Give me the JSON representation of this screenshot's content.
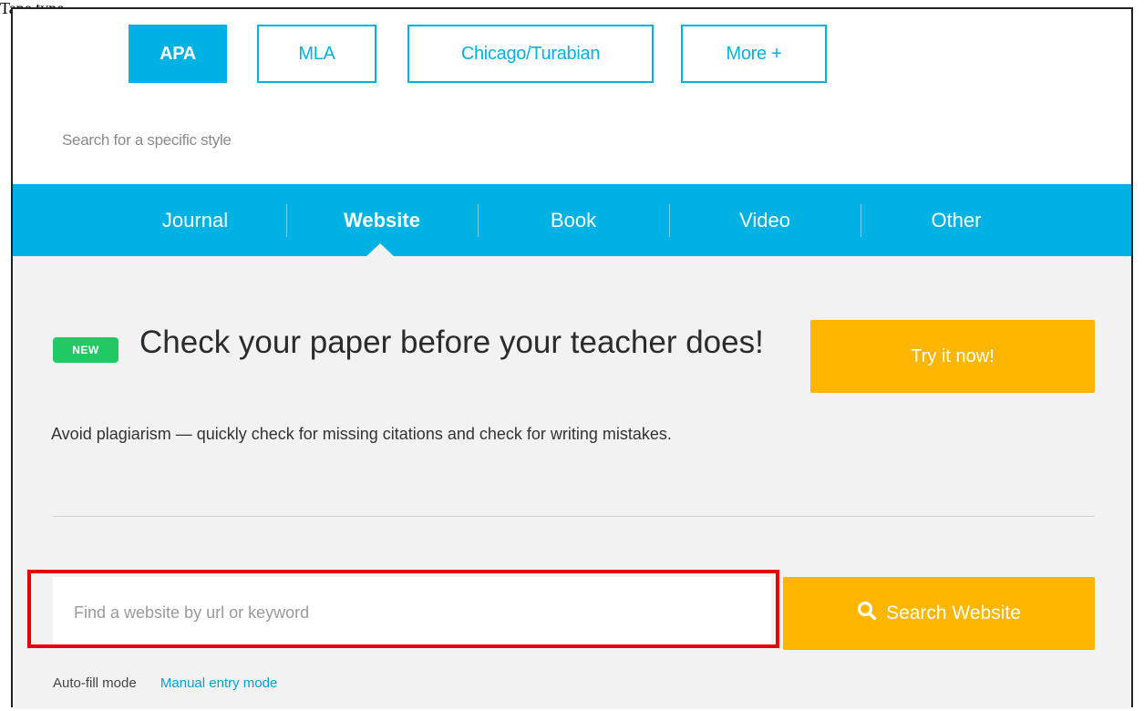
{
  "top_caption": "Tape type",
  "citation_styles": {
    "tabs": [
      {
        "label": "APA",
        "active": true
      },
      {
        "label": "MLA",
        "active": false
      },
      {
        "label": "Chicago/Turabian",
        "active": false
      },
      {
        "label": "More +",
        "active": false
      }
    ],
    "search_placeholder": "Search for a specific style"
  },
  "source_types": {
    "tabs": [
      {
        "label": "Journal",
        "active": false
      },
      {
        "label": "Website",
        "active": true
      },
      {
        "label": "Book",
        "active": false
      },
      {
        "label": "Video",
        "active": false
      },
      {
        "label": "Other",
        "active": false
      }
    ]
  },
  "promo": {
    "badge": "NEW",
    "title": "Check your paper before your teacher does!",
    "description": "Avoid plagiarism — quickly check for missing citations and check for writing mistakes.",
    "cta_label": "Try it now!"
  },
  "website_search": {
    "placeholder": "Find a website by url or keyword",
    "button_label": "Search Website",
    "button_icon": "search-icon"
  },
  "modes": {
    "auto_fill": "Auto-fill mode",
    "manual_entry": "Manual entry mode"
  },
  "colors": {
    "brand_blue": "#00b2e3",
    "cta_yellow": "#ffb600",
    "new_badge_green": "#22c864",
    "highlight_red": "#e80000",
    "content_bg": "#f2f2f2"
  }
}
